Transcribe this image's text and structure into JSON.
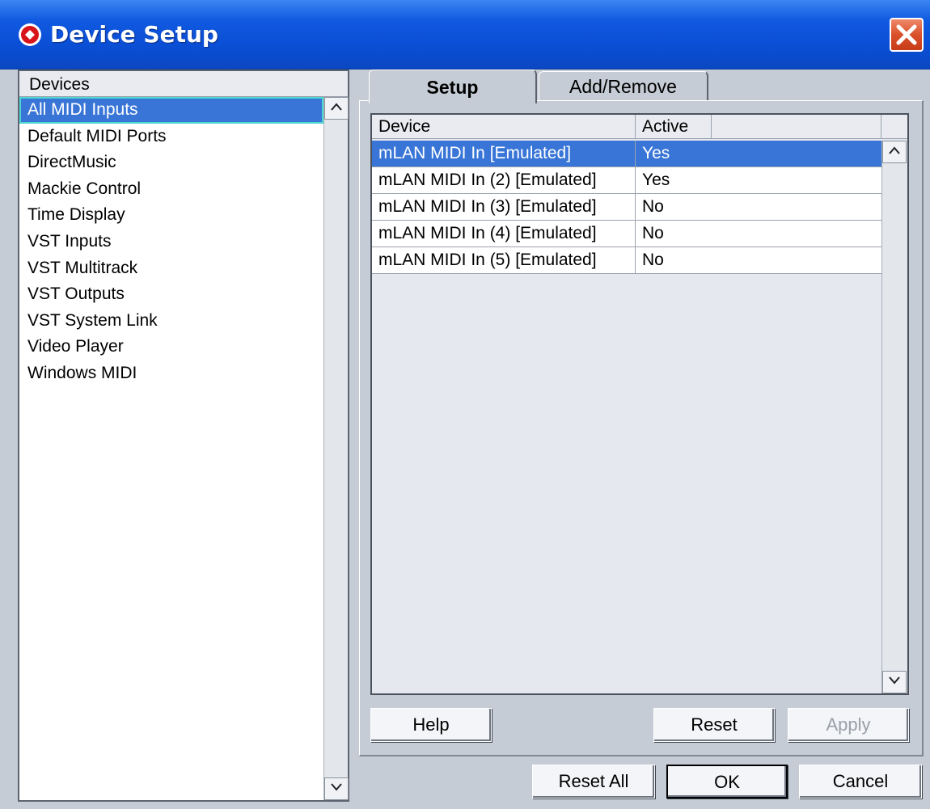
{
  "window": {
    "title": "Device Setup"
  },
  "devices": {
    "header": "Devices",
    "items": [
      "All MIDI Inputs",
      "Default MIDI Ports",
      "DirectMusic",
      "Mackie Control",
      "Time Display",
      "VST Inputs",
      "VST Multitrack",
      "VST Outputs",
      "VST System Link",
      "Video Player",
      "Windows MIDI"
    ],
    "selected_index": 0
  },
  "tabs": [
    {
      "label": "Setup",
      "active": true
    },
    {
      "label": "Add/Remove",
      "active": false
    }
  ],
  "table": {
    "columns": [
      "Device",
      "Active"
    ],
    "rows": [
      {
        "device": "mLAN MIDI In [Emulated]",
        "active": "Yes"
      },
      {
        "device": "mLAN MIDI In (2) [Emulated]",
        "active": "Yes"
      },
      {
        "device": "mLAN MIDI In (3) [Emulated]",
        "active": "No"
      },
      {
        "device": "mLAN MIDI In (4) [Emulated]",
        "active": "No"
      },
      {
        "device": "mLAN MIDI In (5) [Emulated]",
        "active": "No"
      }
    ],
    "selected_index": 0
  },
  "panel_buttons": {
    "help": "Help",
    "reset": "Reset",
    "apply": "Apply"
  },
  "dialog_buttons": {
    "reset_all": "Reset All",
    "ok": "OK",
    "cancel": "Cancel"
  },
  "colors": {
    "selection": "#3875d7",
    "titlebar": "#0a4fd6",
    "close": "#d9502a",
    "dialog_bg": "#c5ccd5"
  }
}
